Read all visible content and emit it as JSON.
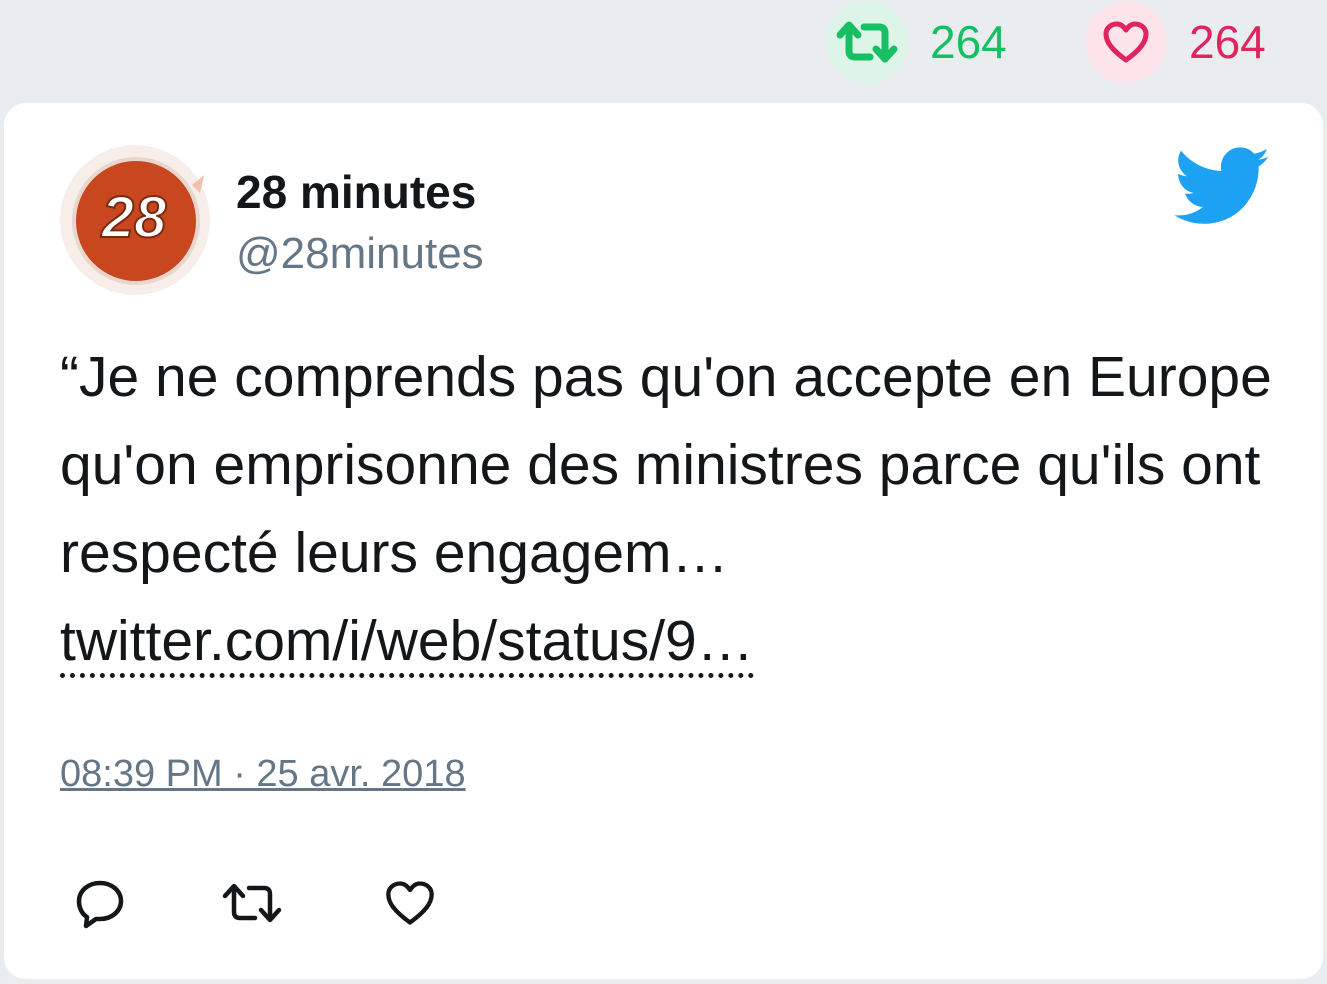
{
  "stats": {
    "retweets": "264",
    "likes": "264",
    "retweet_icon": "retweet-icon",
    "like_icon": "heart-icon",
    "retweet_color": "#17bf63",
    "like_color": "#e0245e"
  },
  "tweet": {
    "author_name": "28 minutes",
    "author_handle": "@28minutes",
    "avatar_text": "28",
    "text": "“Je ne comprends pas qu'on accepte en Europe qu'on emprisonne des ministres parce qu'ils ont respecté leurs engagem… ",
    "link": "twitter.com/i/web/status/9…",
    "timestamp": "08:39 PM · 25 avr. 2018"
  },
  "icons": {
    "brand": "twitter-bird-icon",
    "reply": "reply-icon",
    "retweet": "retweet-icon",
    "like": "heart-icon"
  },
  "colors": {
    "twitter_blue": "#1da1f2",
    "text": "#14171a",
    "muted": "#657786"
  }
}
